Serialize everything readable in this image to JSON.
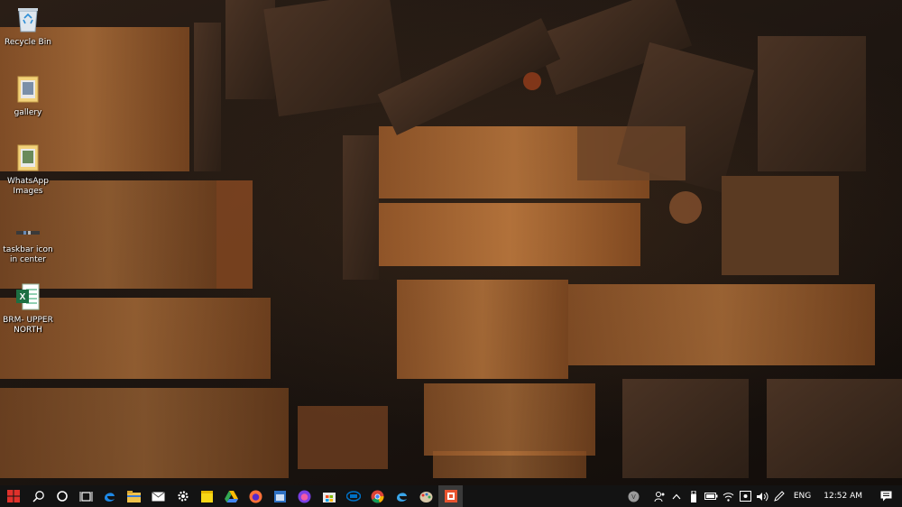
{
  "desktop": {
    "icons": [
      {
        "name": "recycle-bin",
        "label": "Recycle Bin",
        "icon": "recycle-bin-icon"
      },
      {
        "name": "gallery",
        "label": "gallery",
        "icon": "folder-icon"
      },
      {
        "name": "whatsapp-images",
        "label": "WhatsApp Images",
        "icon": "folder-icon"
      },
      {
        "name": "taskbar-icon-in-center",
        "label": "taskbar icon in center",
        "icon": "shortcut-icon"
      },
      {
        "name": "brm-upper-north",
        "label": "BRM- UPPER NORTH",
        "icon": "excel-file-icon"
      }
    ]
  },
  "taskbar": {
    "pinned": [
      "start-windows-icon",
      "search-icon",
      "cortana-circle-icon",
      "task-view-icon",
      "edge-icon",
      "file-explorer-icon",
      "mail-icon",
      "settings-gear-icon",
      "sticky-notes-icon",
      "google-drive-icon",
      "firefox-icon",
      "calendar-icon",
      "firefox-developer-icon",
      "microsoft-store-icon",
      "intel-icon",
      "chrome-icon",
      "edge-beta-icon",
      "paint-icon",
      "snip-tool-icon"
    ],
    "tray": {
      "language": "ENG",
      "time": "12:52 AM",
      "icons": [
        "user-avatar-icon",
        "people-icon",
        "chevron-up-icon",
        "usb-icon",
        "battery-icon",
        "wifi-icon",
        "location-icon",
        "volume-icon",
        "pen-icon"
      ]
    },
    "colors": {
      "accent_red": "#e0312b",
      "background": "#131313"
    }
  }
}
